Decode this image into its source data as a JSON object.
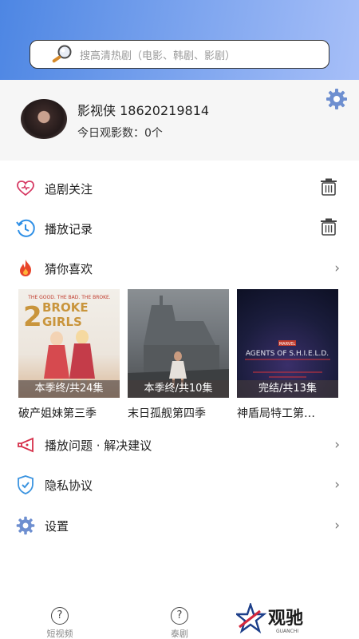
{
  "search": {
    "placeholder": "搜高清热剧（电影、韩剧、影剧）"
  },
  "profile": {
    "name": "影视侠 18620219814",
    "today_count": "今日观影数：0个"
  },
  "menu": {
    "follow": "追剧关注",
    "history": "播放记录",
    "guess": "猜你喜欢",
    "feedback": "播放问题 · 解决建议",
    "privacy": "隐私协议",
    "settings": "设置"
  },
  "recommend": [
    {
      "title": "破产姐妹第三季",
      "badge": "本季终/共24集",
      "poster_text": "2 BROKE GIRLS",
      "tagline": "THE GOOD. THE BAD. THE BROKE."
    },
    {
      "title": "末日孤舰第四季",
      "badge": "本季终/共10集"
    },
    {
      "title": "神盾局特工第…",
      "badge": "完结/共13集",
      "poster_text": "AGENTS OF S.H.I.E.L.D.",
      "brand_mark": "MARVEL"
    }
  ],
  "tabs": [
    {
      "label": "短视频"
    },
    {
      "label": "泰剧"
    }
  ],
  "brand": {
    "name": "观驰",
    "sub": "GUANCHI"
  },
  "colors": {
    "accent": "#4d86e3",
    "heart": "#d63a64",
    "history": "#2e8fe6",
    "fire": "#e8442a",
    "shield": "#3b94e0",
    "gear": "#6e8fd0"
  }
}
